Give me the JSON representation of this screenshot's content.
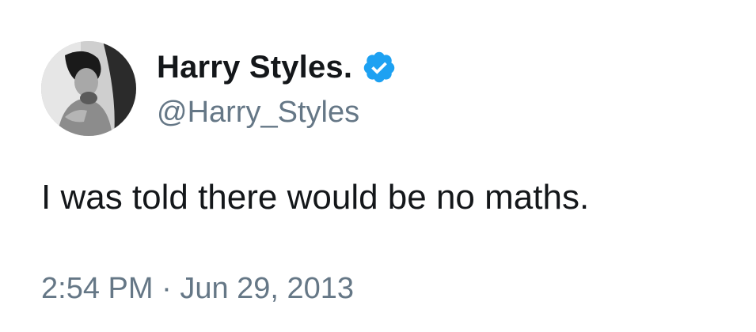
{
  "author": {
    "display_name": "Harry Styles.",
    "handle": "@Harry_Styles",
    "verified": true,
    "verified_badge_icon": "verified-badge-icon",
    "avatar_icon": "profile-photo"
  },
  "tweet": {
    "text": "I was told there would be no maths."
  },
  "meta": {
    "time": "2:54 PM",
    "separator": " · ",
    "date": "Jun 29, 2013"
  },
  "colors": {
    "primary_text": "#14171a",
    "secondary_text": "#657786",
    "verified_blue": "#1da1f2",
    "background": "#ffffff"
  }
}
